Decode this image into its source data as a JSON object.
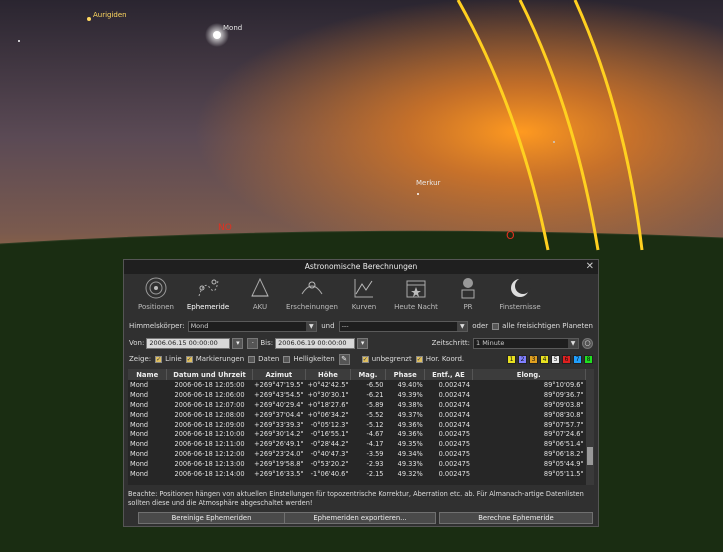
{
  "sky": {
    "labels": {
      "aurigiden": "Aurigiden",
      "mond": "Mond",
      "merkur": "Merkur",
      "no": "NO",
      "o": "O"
    }
  },
  "dialog": {
    "title": "Astronomische Berechnungen",
    "close": "✕",
    "tabs": [
      {
        "label": "Positionen",
        "icon": "solar-system-icon"
      },
      {
        "label": "Ephemeride",
        "icon": "ephemeris-icon"
      },
      {
        "label": "AKU",
        "icon": "telescope-icon"
      },
      {
        "label": "Erscheinungen",
        "icon": "phenomena-icon"
      },
      {
        "label": "Kurven",
        "icon": "curves-icon"
      },
      {
        "label": "Heute Nacht",
        "icon": "tonight-icon"
      },
      {
        "label": "PR",
        "icon": "pr-icon"
      },
      {
        "label": "Finsternisse",
        "icon": "eclipse-icon"
      }
    ],
    "form": {
      "body_label": "Himmelskörper:",
      "body_value": "Mond",
      "and_label": "und",
      "second_value": "---",
      "or_label": "oder",
      "all_planets_label": "alle freisichtigen Planeten",
      "from_label": "Von:",
      "from_value": "2006.06.15 00:00:00",
      "to_label": "Bis:",
      "to_value": "2006.06.19 00:00:00",
      "step_label": "Zeitschritt:",
      "step_value": "1 Minute",
      "show_label": "Zeige:",
      "line_label": "Linie",
      "marks_label": "Markierungen",
      "dates_label": "Daten",
      "brightness_label": "Helligkeiten",
      "unlimited_label": "unbegrenzt",
      "horcoord_label": "Hor. Koord.",
      "color_swatches": [
        {
          "n": "1",
          "color": "#e8e020"
        },
        {
          "n": "2",
          "color": "#8080ff"
        },
        {
          "n": "3",
          "color": "#e0a020"
        },
        {
          "n": "4",
          "color": "#e8e020"
        },
        {
          "n": "5",
          "color": "#e8e8e8"
        },
        {
          "n": "6",
          "color": "#e02020"
        },
        {
          "n": "7",
          "color": "#20a0ff"
        },
        {
          "n": "8",
          "color": "#20e020"
        }
      ]
    },
    "table": {
      "columns": [
        "Name",
        "Datum und Uhrzeit",
        "Azimut",
        "Höhe",
        "Mag.",
        "Phase",
        "Entf., AE",
        "Elong."
      ],
      "rows": [
        [
          "Mond",
          "2006-06-18 12:05:00",
          "+269°47'19.5\"",
          "+0°42'42.5\"",
          "-6.50",
          "49.40%",
          "0.002474",
          "89°10'09.6\""
        ],
        [
          "Mond",
          "2006-06-18 12:06:00",
          "+269°43'54.5\"",
          "+0°30'30.1\"",
          "-6.21",
          "49.39%",
          "0.002474",
          "89°09'36.7\""
        ],
        [
          "Mond",
          "2006-06-18 12:07:00",
          "+269°40'29.4\"",
          "+0°18'27.6\"",
          "-5.89",
          "49.38%",
          "0.002474",
          "89°09'03.8\""
        ],
        [
          "Mond",
          "2006-06-18 12:08:00",
          "+269°37'04.4\"",
          "+0°06'34.2\"",
          "-5.52",
          "49.37%",
          "0.002474",
          "89°08'30.8\""
        ],
        [
          "Mond",
          "2006-06-18 12:09:00",
          "+269°33'39.3\"",
          "-0°05'12.3\"",
          "-5.12",
          "49.36%",
          "0.002474",
          "89°07'57.7\""
        ],
        [
          "Mond",
          "2006-06-18 12:10:00",
          "+269°30'14.2\"",
          "-0°16'55.1\"",
          "-4.67",
          "49.36%",
          "0.002475",
          "89°07'24.6\""
        ],
        [
          "Mond",
          "2006-06-18 12:11:00",
          "+269°26'49.1\"",
          "-0°28'44.2\"",
          "-4.17",
          "49.35%",
          "0.002475",
          "89°06'51.4\""
        ],
        [
          "Mond",
          "2006-06-18 12:12:00",
          "+269°23'24.0\"",
          "-0°40'47.3\"",
          "-3.59",
          "49.34%",
          "0.002475",
          "89°06'18.2\""
        ],
        [
          "Mond",
          "2006-06-18 12:13:00",
          "+269°19'58.8\"",
          "-0°53'20.2\"",
          "-2.93",
          "49.33%",
          "0.002475",
          "89°05'44.9\""
        ],
        [
          "Mond",
          "2006-06-18 12:14:00",
          "+269°16'33.5\"",
          "-1°06'40.6\"",
          "-2.15",
          "49.32%",
          "0.002475",
          "89°05'11.5\""
        ]
      ]
    },
    "note": "Beachte: Positionen hängen von aktuellen Einstellungen für topozentrische Korrektur, Aberration etc. ab. Für Almanach-artige Datenlisten sollten diese und die Atmosphäre abgeschaltet werden!",
    "buttons": {
      "clear": "Bereinige Ephemeriden",
      "export": "Ephemeriden exportieren...",
      "compute": "Berechne Ephemeride"
    }
  }
}
